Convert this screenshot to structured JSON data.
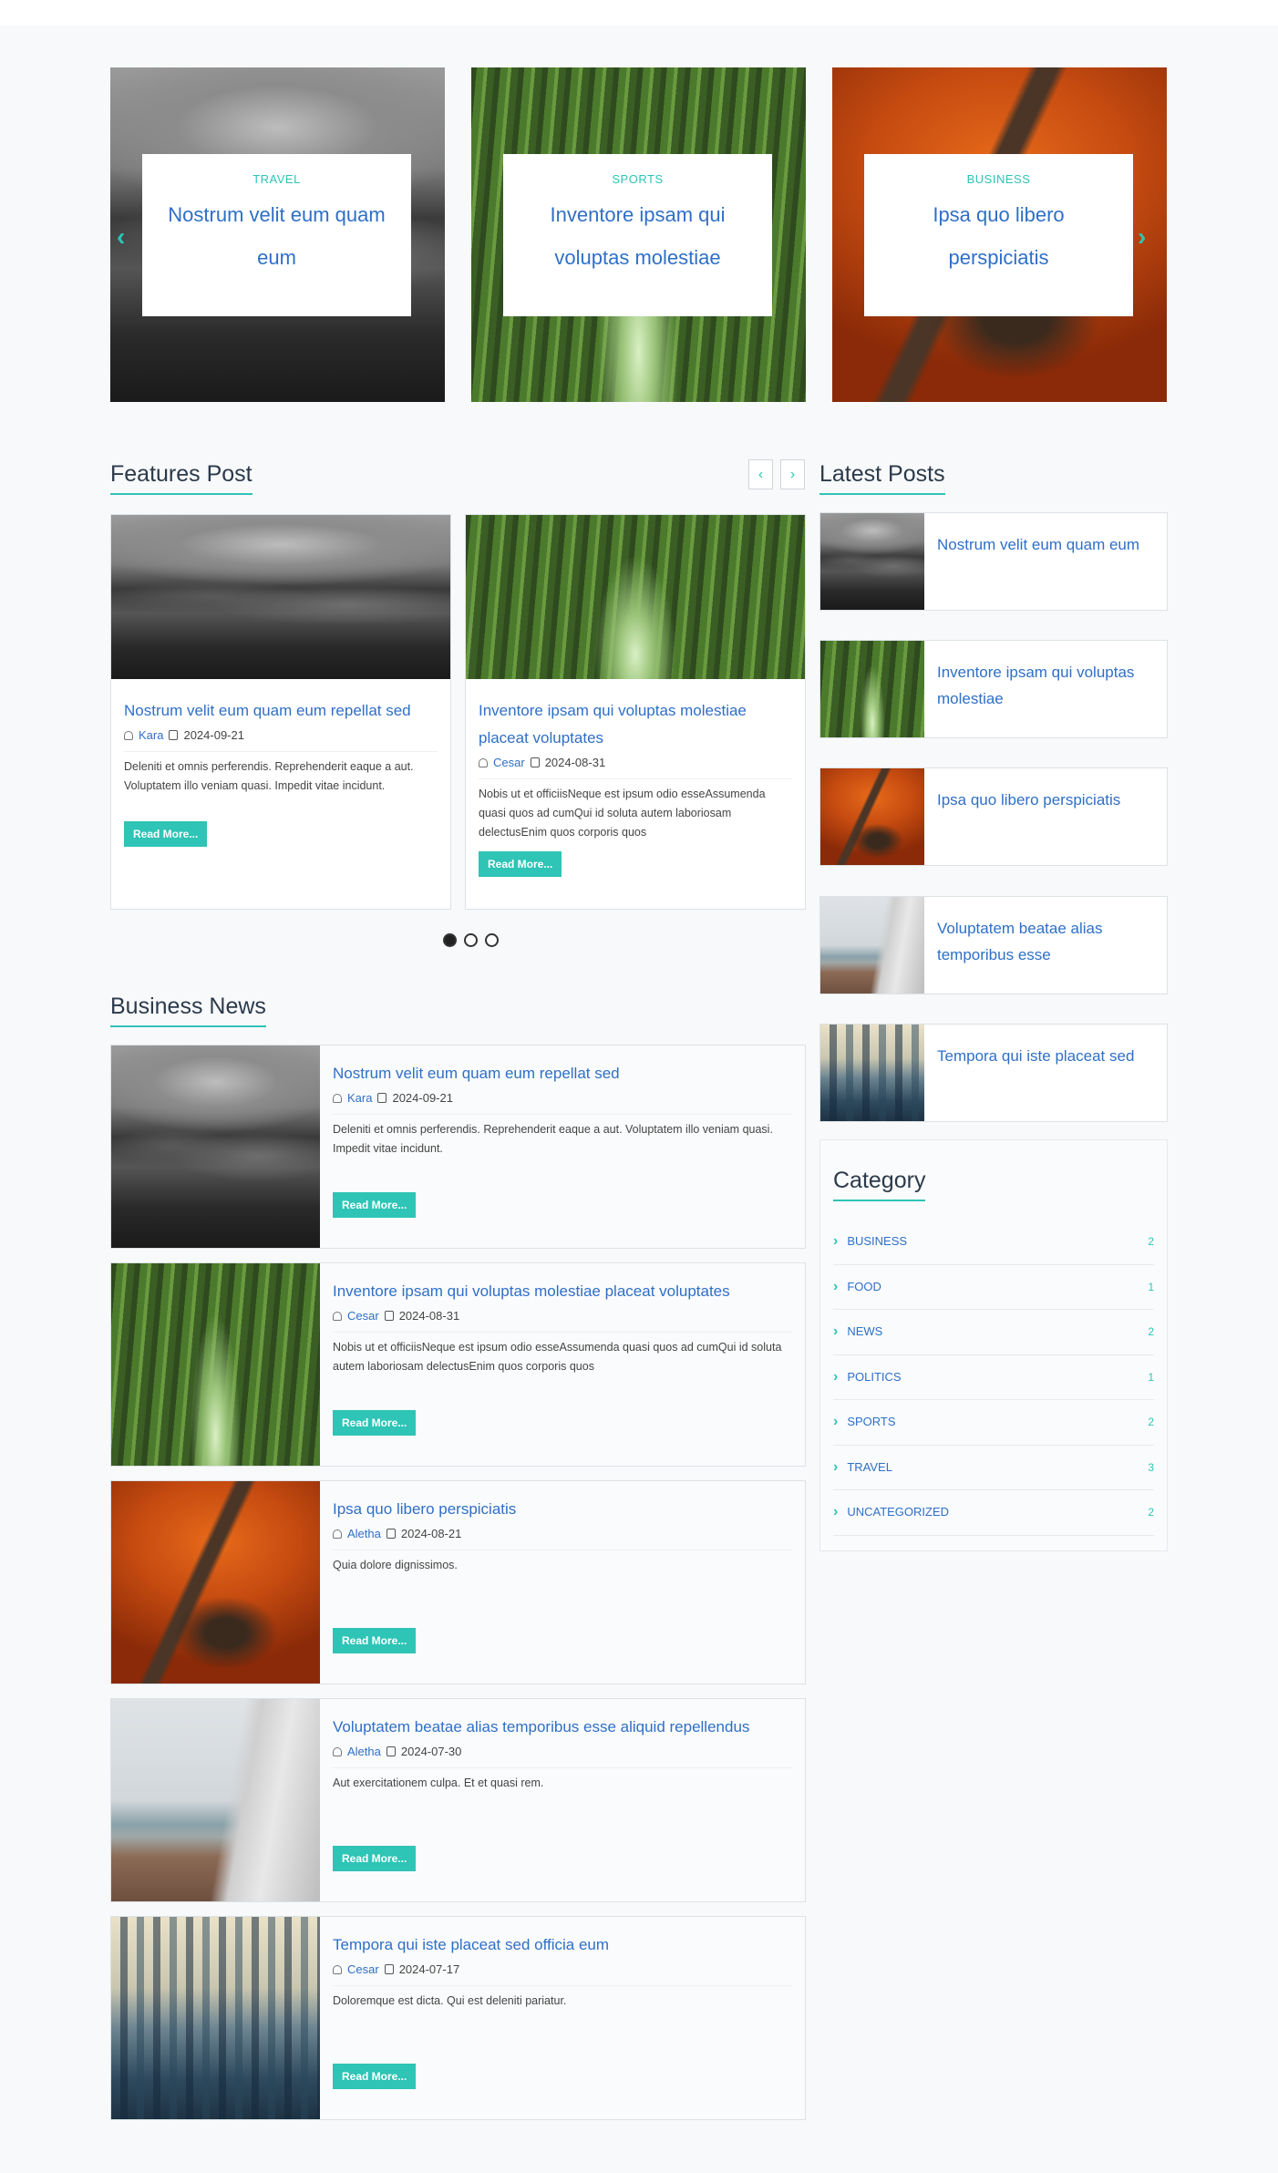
{
  "hero": [
    {
      "category": "TRAVEL",
      "title": "Nostrum velit eum quam eum",
      "image": "rocks"
    },
    {
      "category": "SPORTS",
      "title": "Inventore ipsam qui voluptas molestiae",
      "image": "forest"
    },
    {
      "category": "BUSINESS",
      "title": "Ipsa quo libero perspiciatis",
      "image": "autumn"
    }
  ],
  "hero_nav": {
    "prev": "‹",
    "next": "›"
  },
  "features": {
    "heading": "Features Post",
    "prev": "‹",
    "next": "›",
    "posts": [
      {
        "title": "Nostrum velit eum quam eum repellat sed",
        "author": "Kara",
        "date": "2024-09-21",
        "excerpt": "Deleniti et omnis perferendis. Reprehenderit eaque a aut. Voluptatem illo veniam quasi. Impedit vitae incidunt.",
        "read_more": "Read More..."
      },
      {
        "title": "Inventore ipsam qui voluptas molestiae placeat voluptates",
        "author": "Cesar",
        "date": "2024-08-31",
        "excerpt": "Nobis ut et officiisNeque est ipsum odio esseAssumenda quasi quos ad cumQui id soluta autem laboriosam delectusEnim quos corporis quos",
        "read_more": "Read More..."
      }
    ]
  },
  "business": {
    "heading": "Business News",
    "posts": [
      {
        "title": "Nostrum velit eum quam eum repellat sed",
        "author": "Kara",
        "date": "2024-09-21",
        "excerpt": "Deleniti et omnis perferendis. Reprehenderit eaque a aut. Voluptatem illo veniam quasi. Impedit vitae incidunt.",
        "read_more": "Read More...",
        "image": "rocks"
      },
      {
        "title": "Inventore ipsam qui voluptas molestiae placeat voluptates",
        "author": "Cesar",
        "date": "2024-08-31",
        "excerpt": "Nobis ut et officiisNeque est ipsum odio esseAssumenda quasi quos ad cumQui id soluta autem laboriosam delectusEnim quos corporis quos",
        "read_more": "Read More...",
        "image": "forest"
      },
      {
        "title": "Ipsa quo libero perspiciatis",
        "author": "Aletha",
        "date": "2024-08-21",
        "excerpt": "Quia dolore dignissimos.",
        "read_more": "Read More...",
        "image": "autumn"
      },
      {
        "title": "Voluptatem beatae alias temporibus esse aliquid repellendus",
        "author": "Aletha",
        "date": "2024-07-30",
        "excerpt": "Aut exercitationem culpa. Et et quasi rem.",
        "read_more": "Read More...",
        "image": "beach"
      },
      {
        "title": "Tempora qui iste placeat sed officia eum",
        "author": "Cesar",
        "date": "2024-07-17",
        "excerpt": "Doloremque est dicta. Qui est deleniti pariatur.",
        "read_more": "Read More...",
        "image": "city"
      }
    ]
  },
  "latest": {
    "heading": "Latest Posts",
    "posts": [
      {
        "title": "Nostrum velit eum quam eum",
        "image": "rocks"
      },
      {
        "title": "Inventore ipsam qui voluptas molestiae",
        "image": "forest"
      },
      {
        "title": "Ipsa quo libero perspiciatis",
        "image": "autumn"
      },
      {
        "title": "Voluptatem beatae alias temporibus esse",
        "image": "beach"
      },
      {
        "title": "Tempora qui iste placeat sed",
        "image": "city"
      }
    ]
  },
  "category": {
    "heading": "Category",
    "items": [
      {
        "name": "BUSINESS",
        "count": "2"
      },
      {
        "name": "FOOD",
        "count": "1"
      },
      {
        "name": "NEWS",
        "count": "2"
      },
      {
        "name": "POLITICS",
        "count": "1"
      },
      {
        "name": "SPORTS",
        "count": "2"
      },
      {
        "name": "TRAVEL",
        "count": "3"
      },
      {
        "name": "UNCATEGORIZED",
        "count": "2"
      }
    ]
  },
  "colors": {
    "accent": "#2ec4b6",
    "link": "#2f6fc7",
    "heading": "#2b3a4a"
  }
}
